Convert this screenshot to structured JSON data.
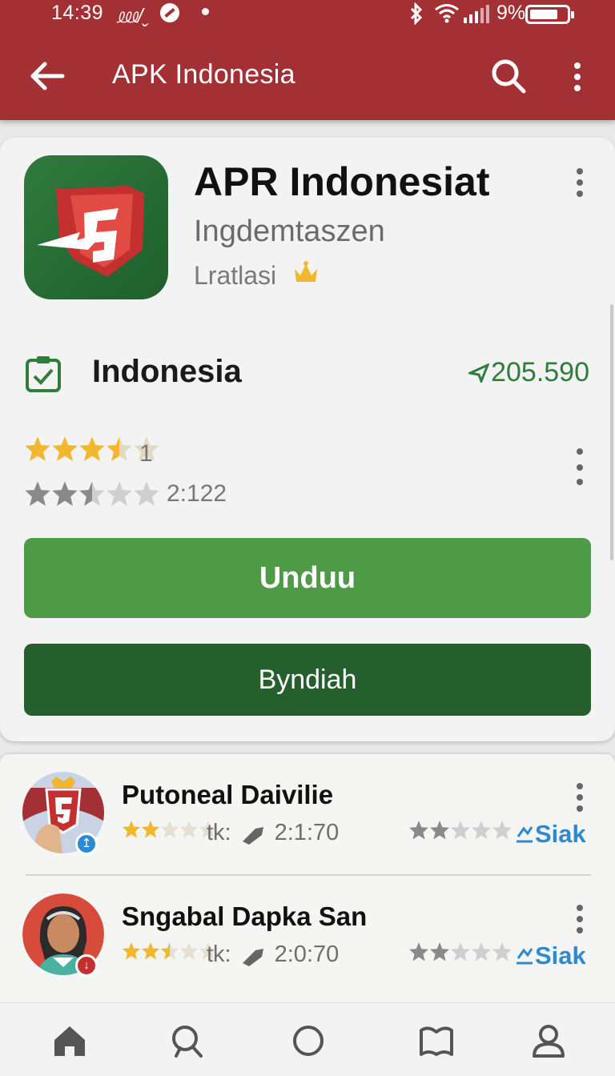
{
  "status_bar": {
    "time": "14:39",
    "note": "⅏/ˬ",
    "battery": "9%"
  },
  "app_bar": {
    "title": "APK Indonesia"
  },
  "app": {
    "name": "APR Indonesiat",
    "developer": "Ingdemtaszen",
    "category": "Lratlasi",
    "region_label": "Indonesia",
    "downloads": "205.590",
    "rating_1": "1",
    "rating_1_stars": 3.5,
    "rating_2": "2:122",
    "rating_2_stars": 2.5,
    "primary_button": "Unduu",
    "secondary_button": "Byndiah"
  },
  "list": [
    {
      "title": "Putoneal Daivilie",
      "meta": "2:1:70",
      "stars_short": "tk:",
      "action": "Siak"
    },
    {
      "title": "Sngabal Dapka San",
      "meta": "2:0:70",
      "stars_short": "tk:",
      "action": "Siak"
    }
  ],
  "colors": {
    "app_bar": "#a33034",
    "primary_button": "#4e9a47",
    "secondary_button": "#255f2d",
    "accent_link": "#2d8ad1",
    "downloads_green": "#2e7d3a",
    "star_gold": "#f0b72f"
  },
  "icons": {
    "back": "arrow-left-icon",
    "search": "search-icon",
    "more": "more-vert-icon",
    "region": "clipboard-check-icon",
    "crown": "crown-icon",
    "nav": [
      "home-icon",
      "search-icon",
      "circle-icon",
      "book-icon",
      "profile-icon"
    ]
  }
}
